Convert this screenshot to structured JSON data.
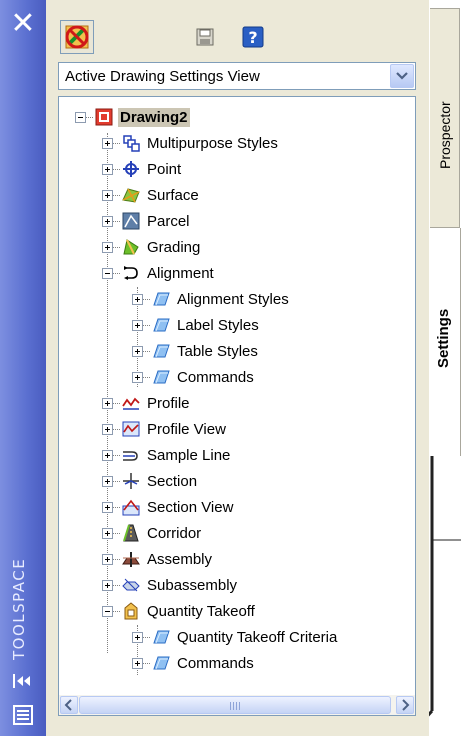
{
  "window": {
    "title": "TOOLSPACE",
    "close_icon": "close-icon",
    "autohide_icon": "autohide-icon",
    "properties_icon": "properties-icon"
  },
  "toolbar": {
    "buttons": [
      "catalog-icon",
      "save-icon",
      "help-icon"
    ]
  },
  "view_selector": {
    "value": "Active Drawing Settings View"
  },
  "tree": {
    "root": "Drawing2",
    "items": [
      {
        "label": "Multipurpose Styles",
        "icon": "multipurpose-styles-icon"
      },
      {
        "label": "Point",
        "icon": "point-icon"
      },
      {
        "label": "Surface",
        "icon": "surface-icon"
      },
      {
        "label": "Parcel",
        "icon": "parcel-icon"
      },
      {
        "label": "Grading",
        "icon": "grading-icon"
      },
      {
        "label": "Alignment",
        "icon": "alignment-icon",
        "expanded": true
      },
      {
        "label": "Alignment Styles",
        "icon": "folder-icon"
      },
      {
        "label": "Label Styles",
        "icon": "folder-icon"
      },
      {
        "label": "Table Styles",
        "icon": "folder-icon"
      },
      {
        "label": "Commands",
        "icon": "folder-icon"
      },
      {
        "label": "Profile",
        "icon": "profile-icon"
      },
      {
        "label": "Profile View",
        "icon": "profile-view-icon"
      },
      {
        "label": "Sample Line",
        "icon": "sample-line-icon"
      },
      {
        "label": "Section",
        "icon": "section-icon"
      },
      {
        "label": "Section View",
        "icon": "section-view-icon"
      },
      {
        "label": "Corridor",
        "icon": "corridor-icon"
      },
      {
        "label": "Assembly",
        "icon": "assembly-icon"
      },
      {
        "label": "Subassembly",
        "icon": "subassembly-icon"
      },
      {
        "label": "Quantity Takeoff",
        "icon": "quantity-takeoff-icon",
        "expanded": true
      },
      {
        "label": "Quantity Takeoff Criteria",
        "icon": "folder-icon"
      },
      {
        "label": "Commands",
        "icon": "folder-icon"
      }
    ]
  },
  "tabs": {
    "prospector": "Prospector",
    "settings": "Settings"
  },
  "colors": {
    "title_strip": "#5a6fd0",
    "panel_bg": "#ece9d8",
    "selection": "#ccc6b4",
    "border": "#7f9db9"
  }
}
